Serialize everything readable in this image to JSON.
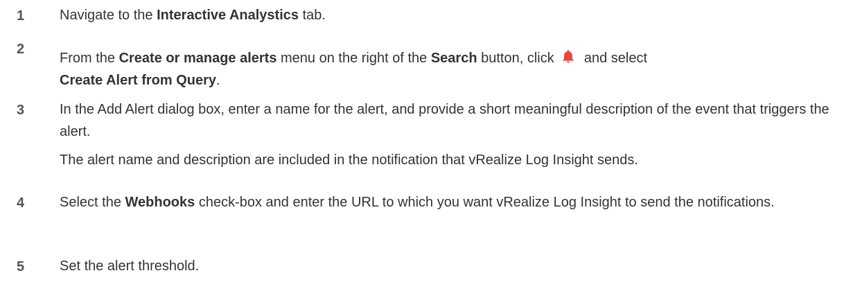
{
  "steps": [
    {
      "number": "1",
      "parts": [
        "Navigate to the ",
        "Interactive Analystics",
        " tab."
      ]
    },
    {
      "number": "2",
      "parts": [
        "From the ",
        "Create or manage alerts",
        " menu on the right of the ",
        "Search",
        " button, click ",
        " and select ",
        "Create Alert from Query",
        "."
      ]
    },
    {
      "number": "3",
      "text": "In the Add Alert dialog box, enter a name for the alert, and provide a short meaningful description of the event that triggers the alert.",
      "note": "The alert name and description are included in the notification that vRealize Log Insight sends."
    },
    {
      "number": "4",
      "parts": [
        "Select the ",
        "Webhooks",
        " check-box and enter the URL to which you want vRealize Log Insight to send the notifications."
      ]
    },
    {
      "number": "5",
      "text": "Set the alert threshold."
    }
  ],
  "icons": {
    "alert_bell": "bell-icon",
    "alert_bell_color": "#e8453c"
  }
}
